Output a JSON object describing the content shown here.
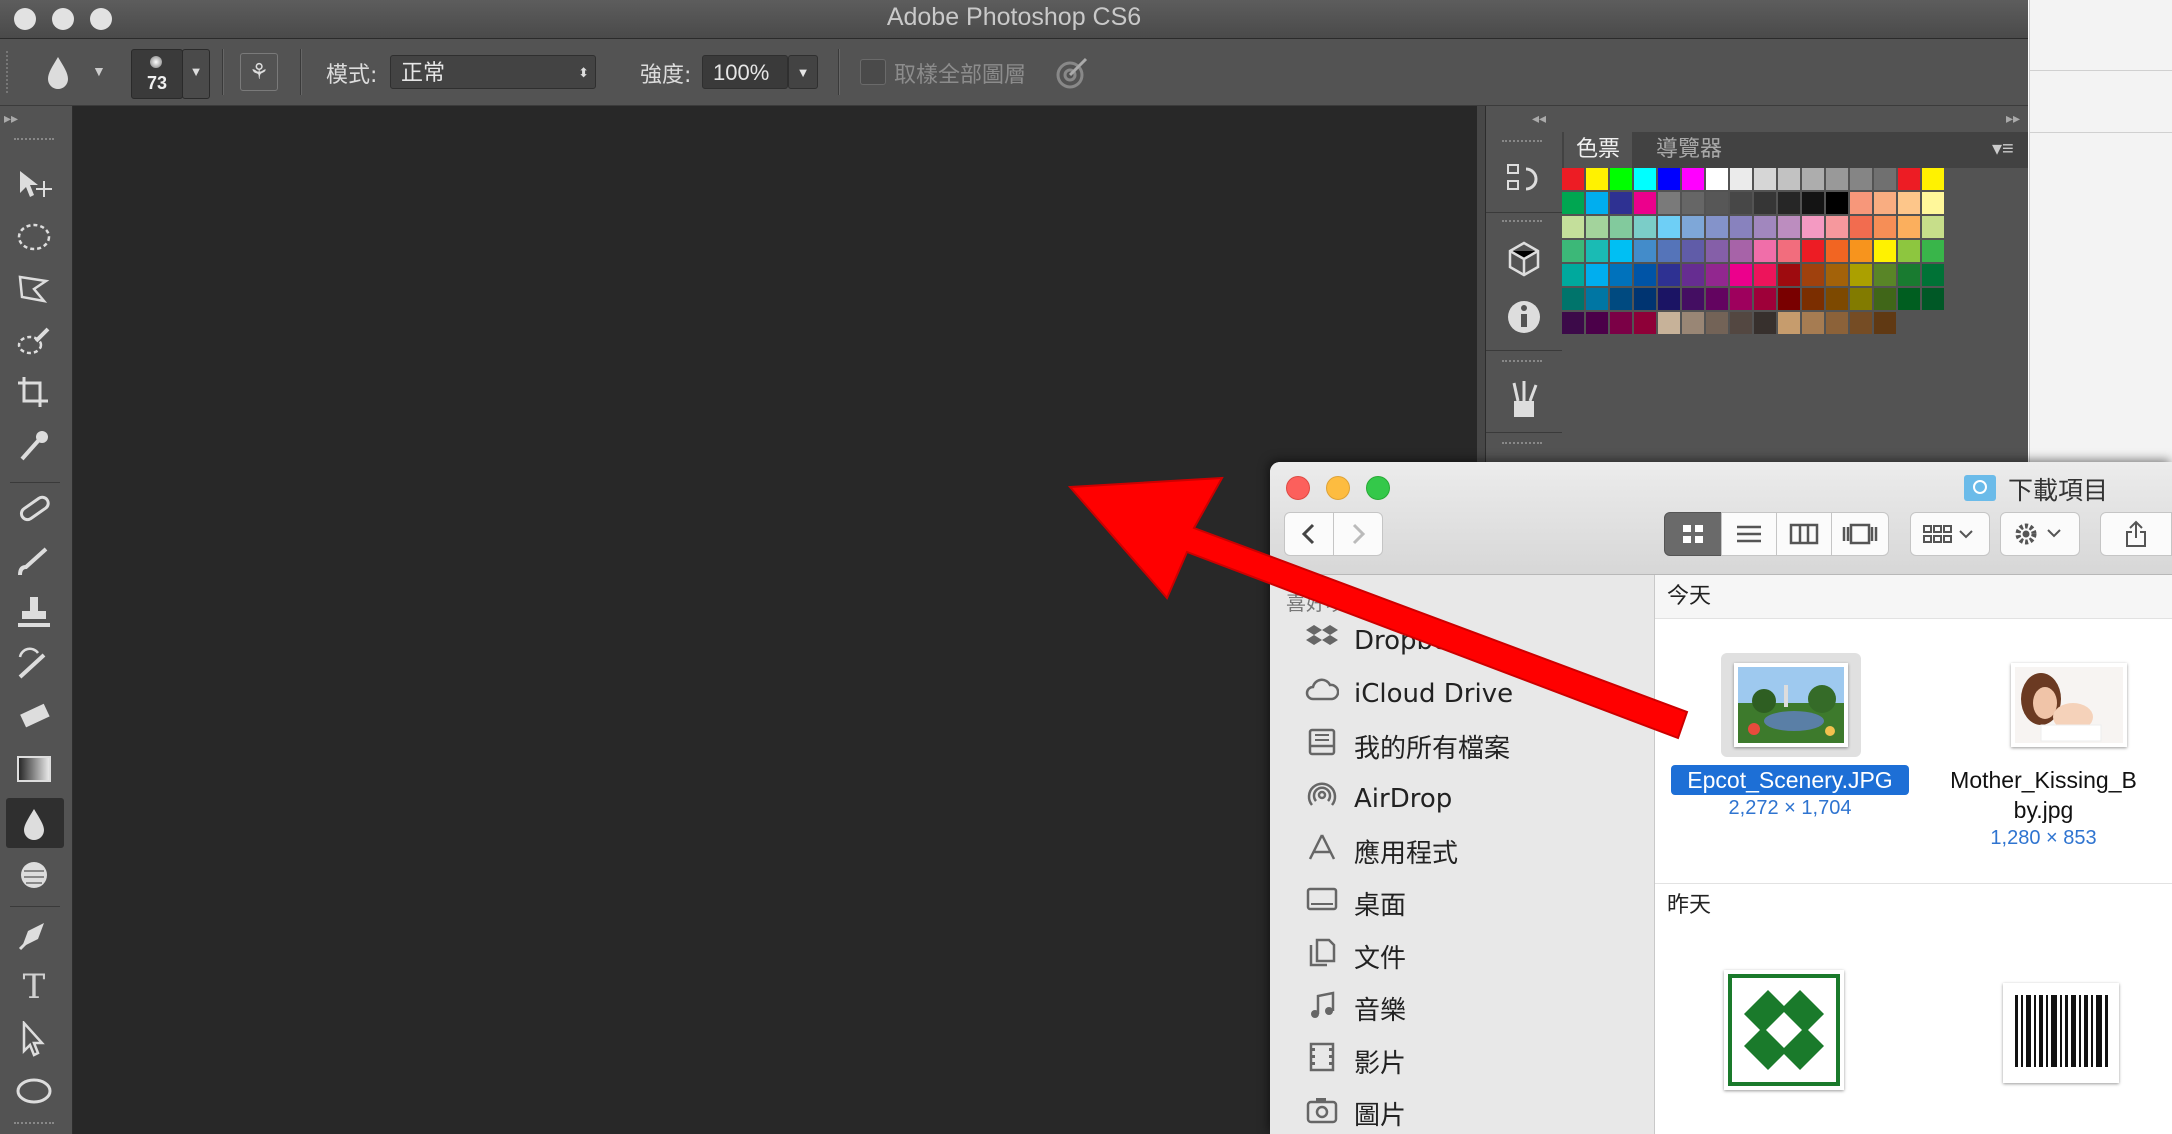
{
  "photoshop": {
    "title": "Adobe Photoshop CS6",
    "options": {
      "brush_size": "73",
      "mode_label": "模式:",
      "mode_value": "正常",
      "strength_label": "強度:",
      "strength_value": "100%",
      "sample_all_label": "取樣全部圖層"
    },
    "panel_tabs": [
      "色票",
      "導覽器"
    ],
    "swatch_rows": [
      [
        "#ed1c24",
        "#fff200",
        "#00ff00",
        "#00ffff",
        "#0000ff",
        "#ff00ff",
        "#ffffff",
        "#ebebeb",
        "#d6d6d6",
        "#c2c2c2",
        "#adadad",
        "#999999",
        "#858585",
        "#707070",
        "#ed1c24",
        "#fff200"
      ],
      [
        "#00a651",
        "#00aeef",
        "#2e3192",
        "#ec008c",
        "#7a7a7a",
        "#666666",
        "#575757",
        "#474747",
        "#363636",
        "#262626",
        "#141414",
        "#000000",
        "#f7977a",
        "#f9ad81",
        "#fdc68a",
        "#fff79a"
      ],
      [
        "#c4df9b",
        "#a3d39c",
        "#82ca9d",
        "#7bcdc8",
        "#6ecff6",
        "#7ea7d8",
        "#8493ca",
        "#8882be",
        "#a187be",
        "#bc8dbf",
        "#f49ac2",
        "#f6989d",
        "#f26c4f",
        "#f68e56",
        "#fbaf5d",
        "#c7de8a"
      ],
      [
        "#3cb878",
        "#1abbb4",
        "#00bff3",
        "#438cca",
        "#5574b9",
        "#605ca8",
        "#855fa8",
        "#a763a8",
        "#f06ea9",
        "#f26d7d",
        "#ed1c24",
        "#f26522",
        "#f7941d",
        "#fff200",
        "#8dc63f",
        "#39b54a"
      ],
      [
        "#00a99d",
        "#00aeef",
        "#0072bc",
        "#0054a6",
        "#2e3192",
        "#662d91",
        "#92278f",
        "#ec008c",
        "#ed145b",
        "#9e0b0f",
        "#a0410d",
        "#a36209",
        "#aba000",
        "#598527",
        "#197b30",
        "#007236"
      ],
      [
        "#00746b",
        "#0076a3",
        "#004a80",
        "#003471",
        "#1b1464",
        "#440e62",
        "#630460",
        "#9e005d",
        "#9e0039",
        "#790000",
        "#7b2e00",
        "#7d4900",
        "#827b00",
        "#406618",
        "#005e20",
        "#005826"
      ],
      [
        "#3c0a49",
        "#4b0049",
        "#7b0046",
        "#8e0038",
        "#c7b299",
        "#998675",
        "#736357",
        "#534741",
        "#37302d",
        "#c69c6d",
        "#a67c52",
        "#8c6239",
        "#754c24",
        "#603913"
      ]
    ]
  },
  "finder": {
    "title": "下載項目",
    "sidebar_header": "喜好項目",
    "sidebar_items": [
      {
        "label": "Dropbox",
        "icon": "dropbox-icon"
      },
      {
        "label": "iCloud Drive",
        "icon": "cloud-icon"
      },
      {
        "label": "我的所有檔案",
        "icon": "all-files-icon"
      },
      {
        "label": "AirDrop",
        "icon": "airdrop-icon"
      },
      {
        "label": "應用程式",
        "icon": "applications-icon"
      },
      {
        "label": "桌面",
        "icon": "desktop-icon"
      },
      {
        "label": "文件",
        "icon": "documents-icon"
      },
      {
        "label": "音樂",
        "icon": "music-icon"
      },
      {
        "label": "影片",
        "icon": "movies-icon"
      },
      {
        "label": "圖片",
        "icon": "pictures-icon"
      }
    ],
    "sections": {
      "today": "今天",
      "yesterday": "昨天"
    },
    "files_today": [
      {
        "name": "Epcot_Scenery.JPG",
        "dims": "2,272 × 1,704",
        "selected": true
      },
      {
        "name_line1": "Mother_Kissing_B",
        "name_line2": "by.jpg",
        "dims": "1,280 × 853",
        "selected": false
      }
    ],
    "colors": {
      "selection": "#1d6fd6",
      "close": "#fc605c",
      "minimize": "#fdbc40",
      "zoom": "#34c84a"
    }
  },
  "annotation": {
    "arrow_color": "#ff0000"
  }
}
